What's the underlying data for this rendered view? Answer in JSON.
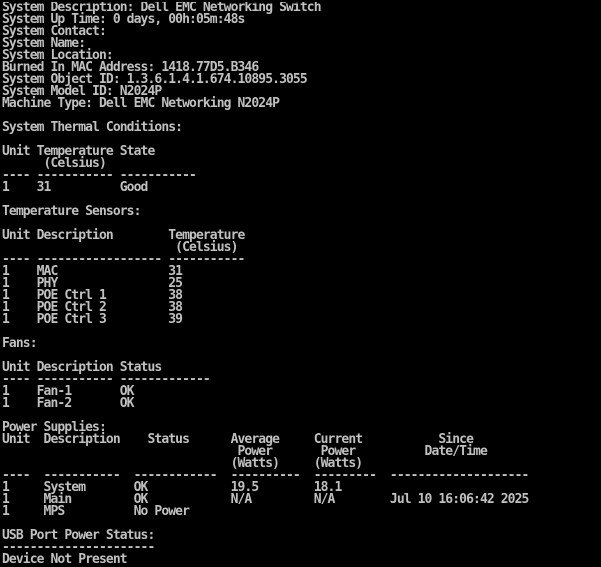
{
  "window": {
    "title": "",
    "colors": {
      "background": "#000000",
      "foreground": "#c0c0c0"
    }
  },
  "terminal": {
    "lines": [
      "System Description: Dell EMC Networking Switch",
      "System Up Time: 0 days, 00h:05m:48s",
      "System Contact:",
      "System Name:",
      "System Location:",
      "Burned In MAC Address: 1418.77D5.B346",
      "System Object ID: 1.3.6.1.4.1.674.10895.3055",
      "System Model ID: N2024P",
      "Machine Type: Dell EMC Networking N2024P",
      "",
      "System Thermal Conditions:",
      "",
      "Unit Temperature State",
      "      (Celsius)",
      "---- ----------- -----------",
      "1    31          Good",
      "",
      "Temperature Sensors:",
      "",
      "Unit Description        Temperature",
      "                         (Celsius)",
      "---- ------------------ -----------",
      "1    MAC                31",
      "1    PHY                25",
      "1    POE Ctrl 1         38",
      "1    POE Ctrl 2         38",
      "1    POE Ctrl 3         39",
      "",
      "Fans:",
      "",
      "Unit Description Status",
      "---- ----------- -------------",
      "1    Fan-1       OK",
      "1    Fan-2       OK",
      "",
      "Power Supplies:",
      "Unit  Description    Status      Average     Current           Since",
      "                                  Power       Power          Date/Time",
      "                                 (Watts)     (Watts)",
      "----  -----------  ------------  ----------  ---------  --------------------",
      "1     System       OK            19.5        18.1",
      "1     Main         OK            N/A         N/A        Jul 10 16:06:42 2025",
      "1     MPS          No Power",
      "",
      "USB Port Power Status:",
      "----------------------",
      "Device Not Present"
    ]
  }
}
